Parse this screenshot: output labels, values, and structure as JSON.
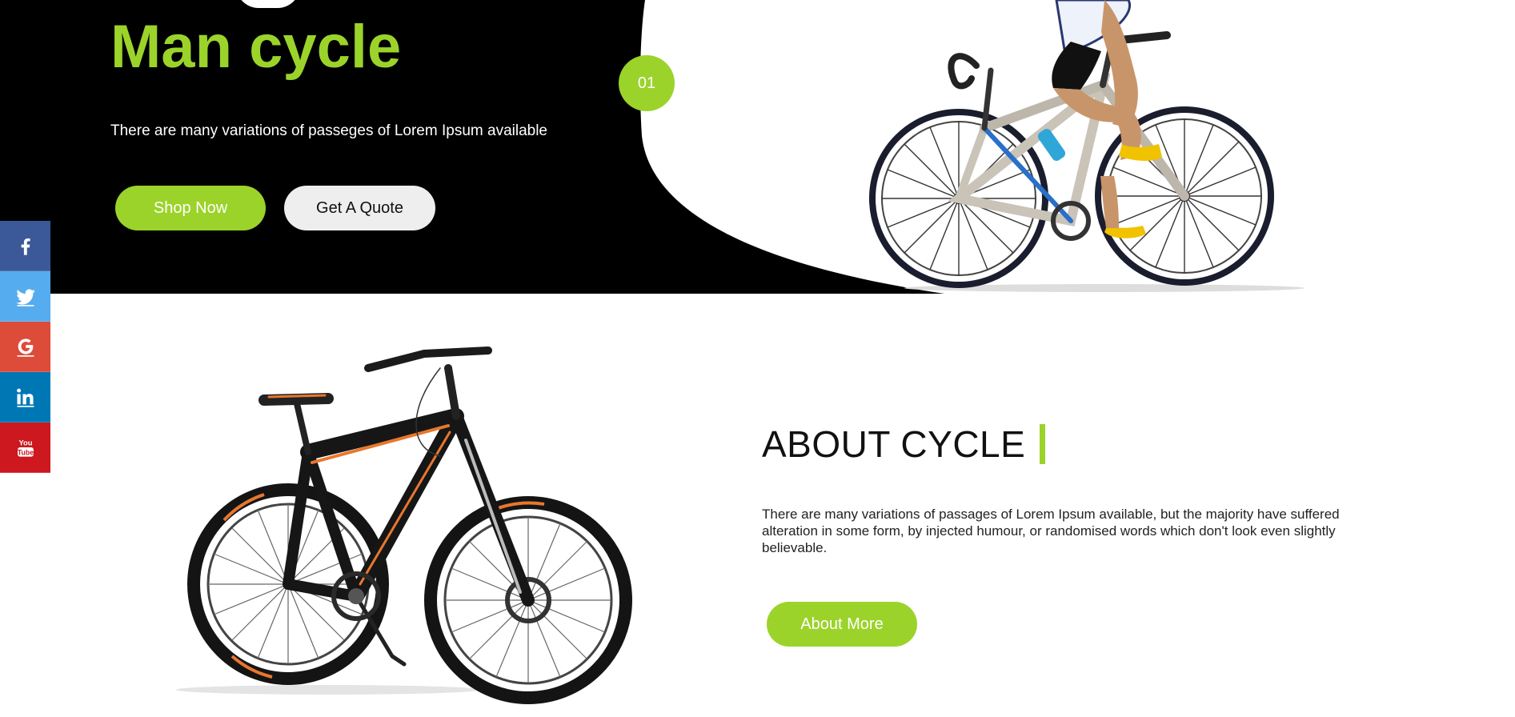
{
  "hero": {
    "title": "Man cycle",
    "subtitle": "There are many variations of passeges of Lorem Ipsum available",
    "shop_button": "Shop Now",
    "quote_button": "Get A Quote",
    "slide_number": "01"
  },
  "social": {
    "items": [
      {
        "network": "facebook",
        "icon": "facebook-icon"
      },
      {
        "network": "twitter",
        "icon": "twitter-icon"
      },
      {
        "network": "google-plus",
        "icon": "google-icon"
      },
      {
        "network": "linkedin",
        "icon": "linkedin-icon"
      },
      {
        "network": "youtube",
        "icon": "youtube-icon"
      }
    ]
  },
  "about": {
    "title": "ABOUT CYCLE",
    "text": "There are many variations of passages of Lorem Ipsum available, but the majority have suffered alteration in some form, by injected humour, or randomised words which don't look even slightly believable.",
    "button": "About More"
  },
  "colors": {
    "accent": "#9bd32a",
    "hero_background": "#000000",
    "facebook": "#3b5998",
    "twitter": "#55acee",
    "google": "#dd4b39",
    "linkedin": "#0077b5",
    "youtube": "#cc181e"
  }
}
